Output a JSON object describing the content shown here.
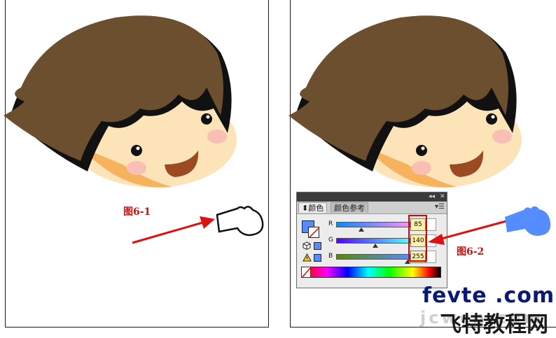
{
  "captions": {
    "left": "图6-1",
    "right": "图6-2"
  },
  "color_panel": {
    "tabs": [
      {
        "label": "颜色",
        "active": true
      },
      {
        "label": "颜色参考",
        "active": false
      }
    ],
    "title_controls": {
      "collapse": "◂◂",
      "close": "✕"
    },
    "menu_icon": "menu-icon",
    "channels": [
      {
        "label": "R",
        "value": "85",
        "fraction": 0.333
      },
      {
        "label": "G",
        "value": "140",
        "fraction": 0.549
      },
      {
        "label": "B",
        "value": "255",
        "fraction": 1.0
      }
    ],
    "fill_color": "#558cff",
    "warning_icon": "warning-icon",
    "cube_icon": "out-of-web-gamut-icon"
  },
  "watermark": {
    "line1": "fevte .com",
    "line2": "飞特教程网",
    "ghost": "jcwcn.com"
  },
  "colors": {
    "hair": "#6b4f2e",
    "skin": "#fde3b8",
    "glove_blue": "#558cff",
    "arrow_red": "#e01010"
  }
}
